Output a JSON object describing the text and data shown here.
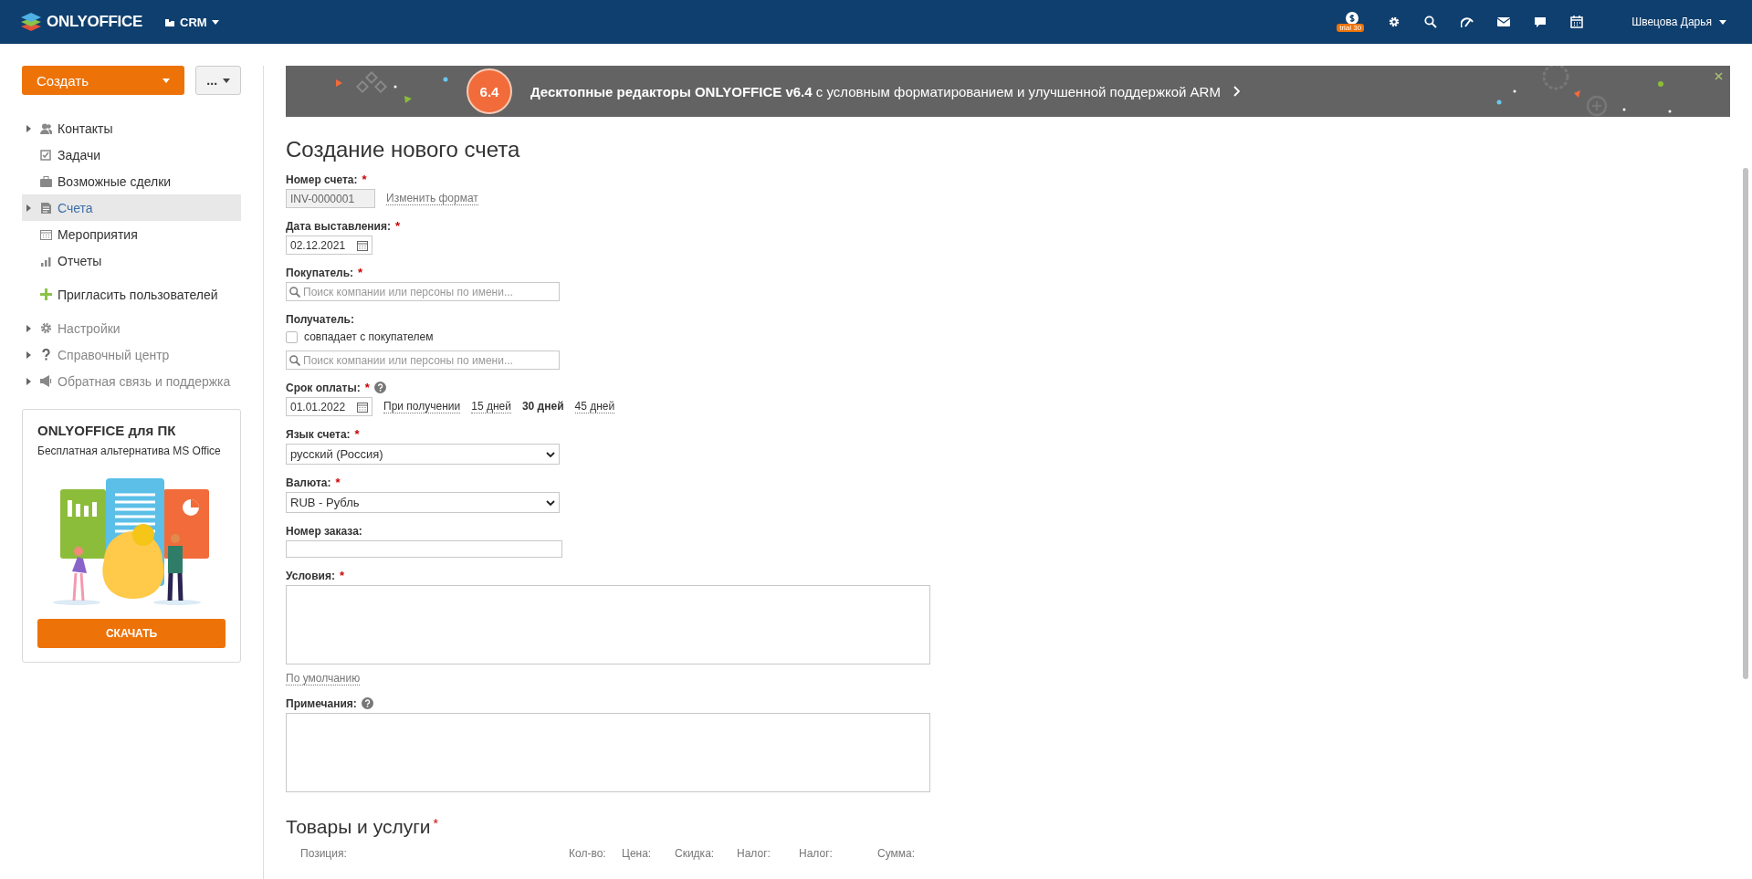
{
  "topbar": {
    "logo": "ONLYOFFICE",
    "module": "CRM",
    "trial_badge": "trial 30",
    "user": "Швецова Дарья"
  },
  "sidebar": {
    "create_button": "Создать",
    "more_button": "...",
    "nav": [
      {
        "label": "Контакты",
        "selected": false,
        "expandable": true,
        "dimmed": false
      },
      {
        "label": "Задачи",
        "selected": false,
        "expandable": false,
        "dimmed": false
      },
      {
        "label": "Возможные сделки",
        "selected": false,
        "expandable": false,
        "dimmed": false
      },
      {
        "label": "Счета",
        "selected": true,
        "expandable": true,
        "dimmed": false
      },
      {
        "label": "Мероприятия",
        "selected": false,
        "expandable": false,
        "dimmed": false
      },
      {
        "label": "Отчеты",
        "selected": false,
        "expandable": false,
        "dimmed": false
      }
    ],
    "invite": "Пригласить пользователей",
    "secondary": [
      {
        "label": "Настройки",
        "selected": false,
        "expandable": true,
        "dimmed": true
      },
      {
        "label": "Справочный центр",
        "selected": false,
        "expandable": true,
        "dimmed": true
      },
      {
        "label": "Обратная связь и поддержка",
        "selected": false,
        "expandable": true,
        "dimmed": true
      }
    ],
    "promo": {
      "title": "ONLYOFFICE для ПК",
      "subtitle": "Бесплатная альтернатива MS Office",
      "button": "СКАЧАТЬ"
    }
  },
  "banner": {
    "badge": "6.4",
    "text": "**Десктопные редакторы ONLYOFFICE v6.4** с условным форматированием и улучшенной поддержкой ARM"
  },
  "form": {
    "title": "Создание нового счета",
    "fields": [
      {
        "kind": "readonly",
        "label": "Номер счета:",
        "required_mark": "*",
        "value": "INV-0000001",
        "link": "Изменить формат"
      },
      {
        "kind": "date",
        "label": "Дата выставления:",
        "required_mark": "*",
        "value": "02.12.2021"
      },
      {
        "kind": "search",
        "label": "Покупатель:",
        "required_mark": "*",
        "placeholder": "Поиск компании или персоны по имени..."
      },
      {
        "kind": "search",
        "label": "Получатель:",
        "checkbox": {
          "label": "совпадает с покупателем",
          "checked": false
        },
        "placeholder": "Поиск компании или персоны по имени..."
      },
      {
        "kind": "date",
        "label": "Срок оплаты:",
        "required_mark": "*",
        "help": true,
        "value": "01.01.2022",
        "presets": [
          {
            "label": "При получении",
            "selected": false
          },
          {
            "label": "15 дней",
            "selected": false
          },
          {
            "label": "30 дней",
            "selected": true
          },
          {
            "label": "45 дней",
            "selected": false
          }
        ]
      },
      {
        "kind": "select",
        "label": "Язык счета:",
        "required_mark": "*",
        "value": "русский (Россия)"
      },
      {
        "kind": "select",
        "label": "Валюта:",
        "required_mark": "*",
        "value": "RUB - Рубль"
      },
      {
        "kind": "text",
        "label": "Номер заказа:"
      },
      {
        "kind": "textarea",
        "label": "Условия:",
        "required_mark": "*",
        "link": "По умолчанию"
      },
      {
        "kind": "textarea",
        "label": "Примечания:",
        "help": true
      }
    ]
  },
  "products": {
    "title": "Товары и услуги",
    "required_mark": "*",
    "columns": [
      "Позиция:",
      "Кол-во:",
      "Цена:",
      "Скидка:",
      "Налог:",
      "Налог:",
      "Сумма:"
    ]
  }
}
